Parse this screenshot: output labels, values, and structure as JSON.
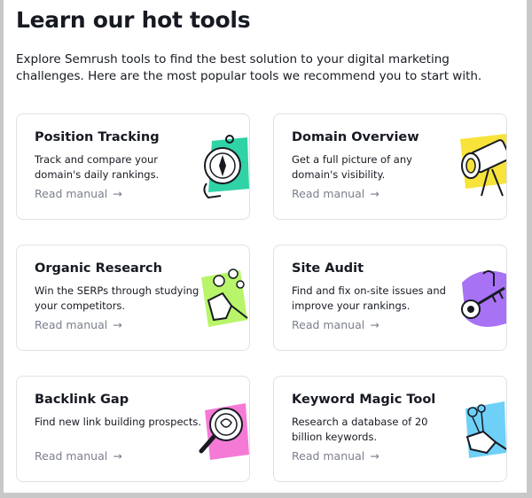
{
  "page": {
    "title": "Learn our hot tools",
    "intro": "Explore Semrush tools to find the best solution to your digital marketing challenges. Here are the most popular tools we recommend you to start with."
  },
  "cards": [
    {
      "title": "Position Tracking",
      "desc": "Track and compare your domain's daily rankings.",
      "link": "Read manual",
      "illustration": "compass-icon",
      "color": "#2fd3a6"
    },
    {
      "title": "Domain Overview",
      "desc": "Get a full picture of any domain's visibility.",
      "link": "Read manual",
      "illustration": "telescope-icon",
      "color": "#f7e33a"
    },
    {
      "title": "Organic Research",
      "desc": "Win the SERPs through studying your competitors.",
      "link": "Read manual",
      "illustration": "hand-icon",
      "color": "#b8f56a"
    },
    {
      "title": "Site Audit",
      "desc": "Find and fix on-site issues and improve your rankings.",
      "link": "Read manual",
      "illustration": "key-icon",
      "color": "#a872f5"
    },
    {
      "title": "Backlink Gap",
      "desc": "Find new link building prospects.",
      "link": "Read manual",
      "illustration": "magnifier-icon",
      "color": "#f57ad6"
    },
    {
      "title": "Keyword Magic Tool",
      "desc": "Research a database of 20 billion keywords.",
      "link": "Read manual",
      "illustration": "magic-key-icon",
      "color": "#6ed0f7"
    }
  ],
  "arrow_glyph": "→"
}
